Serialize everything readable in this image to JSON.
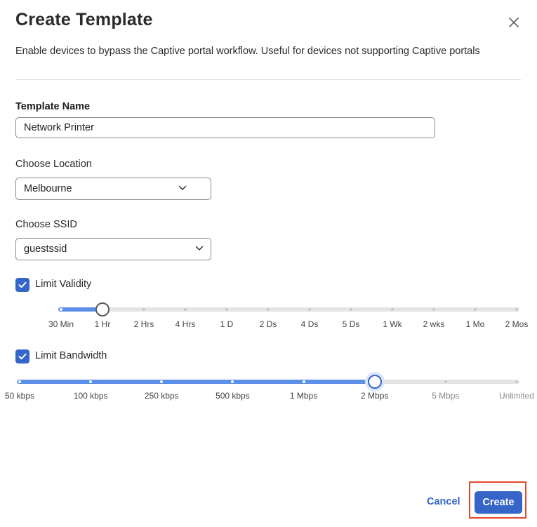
{
  "dialog": {
    "title": "Create Template",
    "subtitle": "Enable devices to bypass the Captive portal workflow. Useful for devices not supporting Captive portals"
  },
  "template_name": {
    "label": "Template Name",
    "value": "Network Printer"
  },
  "location": {
    "label": "Choose Location",
    "selected": "Melbourne"
  },
  "ssid": {
    "label": "Choose SSID",
    "selected": "guestssid"
  },
  "validity": {
    "label": "Limit Validity",
    "checked": true,
    "ticks": [
      "30 Min",
      "1 Hr",
      "2 Hrs",
      "4 Hrs",
      "1 D",
      "2 Ds",
      "4 Ds",
      "5 Ds",
      "1 Wk",
      "2 wks",
      "1 Mo",
      "2 Mos"
    ],
    "selected_index": 1
  },
  "bandwidth": {
    "label": "Limit Bandwidth",
    "checked": true,
    "ticks": [
      "50 kbps",
      "100 kbps",
      "250 kbps",
      "500 kbps",
      "1 Mbps",
      "2 Mbps",
      "5 Mbps",
      "Unlimited"
    ],
    "selected_index": 5
  },
  "footer": {
    "cancel_label": "Cancel",
    "create_label": "Create"
  },
  "colors": {
    "accent": "#3565c9",
    "slider_fill": "#5b8fe8",
    "highlight": "#e4472a"
  },
  "icons": {
    "close": "close-icon",
    "dropdown": "chevron-down-icon",
    "check": "check-icon"
  }
}
